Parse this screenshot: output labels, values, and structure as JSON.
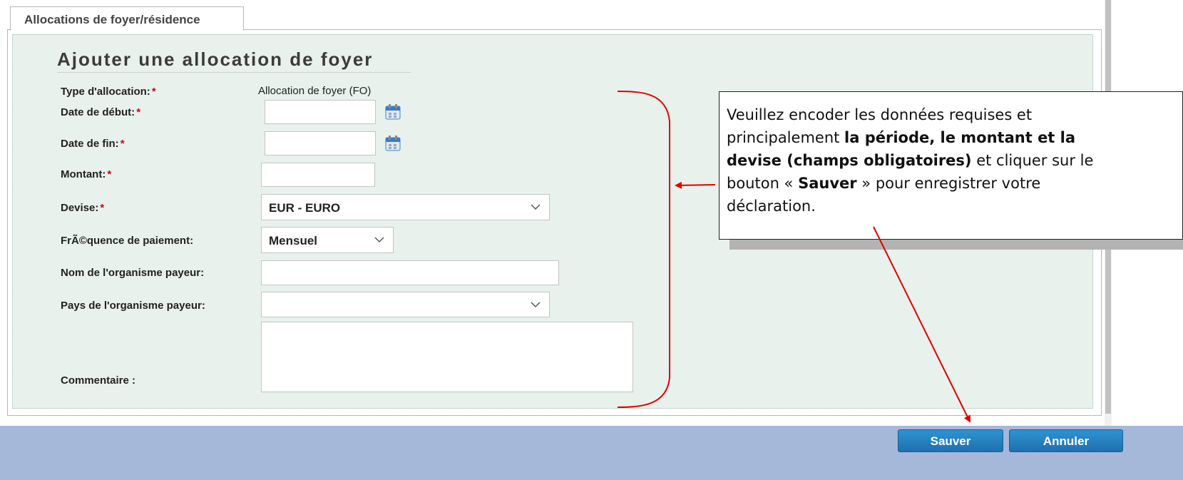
{
  "tab": {
    "label": "Allocations de foyer/résidence"
  },
  "form": {
    "title": "Ajouter une allocation de foyer",
    "required_mark": "*",
    "type": {
      "label": "Type d'allocation:",
      "value": "Allocation de foyer (FO)"
    },
    "start_date": {
      "label": "Date de début:",
      "value": ""
    },
    "end_date": {
      "label": "Date de fin:",
      "value": ""
    },
    "amount": {
      "label": "Montant:",
      "value": ""
    },
    "currency": {
      "label": "Devise:",
      "value": "EUR - EURO"
    },
    "frequency": {
      "label": "FrÃ©quence de paiement:",
      "value": "Mensuel"
    },
    "payer_name": {
      "label": "Nom de l'organisme payeur:",
      "value": ""
    },
    "payer_country": {
      "label": "Pays de l'organisme payeur:",
      "value": ""
    },
    "comment": {
      "label": "Commentaire :",
      "value": ""
    }
  },
  "callout": {
    "line1": "Veuillez encoder les données requises et",
    "line2_plain": "principalement ",
    "line2_bold": "la période, le montant et la",
    "line3_bold": "devise (champs obligatoires)",
    "line3_plain": " et cliquer sur le",
    "line4_a": "bouton « ",
    "line4_bold": "Sauver",
    "line4_b": " » pour enregistrer votre",
    "line5": "déclaration."
  },
  "buttons": {
    "save": "Sauver",
    "cancel": "Annuler"
  },
  "colors": {
    "panel": "#e8f1ec",
    "footer": "#a5b8d9",
    "button": "#2581c4",
    "annotation": "#e00000",
    "required": "#d0021b"
  }
}
